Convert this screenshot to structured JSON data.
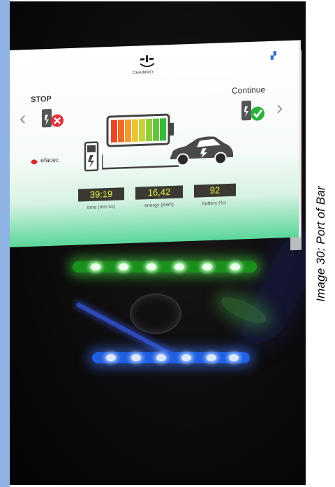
{
  "caption": "Image 30: Port of Bar",
  "screen": {
    "chademo_label": "CHAdeMO",
    "stop_label": "STOP",
    "continue_label": "Continue",
    "brand_logo_text": "efacec",
    "readouts": [
      {
        "value": "39:19",
        "label": "time (min:ss)"
      },
      {
        "value": "16,42",
        "label": "energy (kWh)"
      },
      {
        "value": "92",
        "label": "battery (%)"
      }
    ]
  },
  "colors": {
    "side_stripe": "#8eb4e3",
    "readout_text": "#e8f046",
    "led_green": "#3cdc3c",
    "led_blue": "#3c78ff"
  },
  "icons": [
    "chademo-icon",
    "stop-icon",
    "continue-icon",
    "arrow-left-icon",
    "arrow-right-icon",
    "battery-icon",
    "charger-icon",
    "car-icon",
    "efacec-logo"
  ]
}
